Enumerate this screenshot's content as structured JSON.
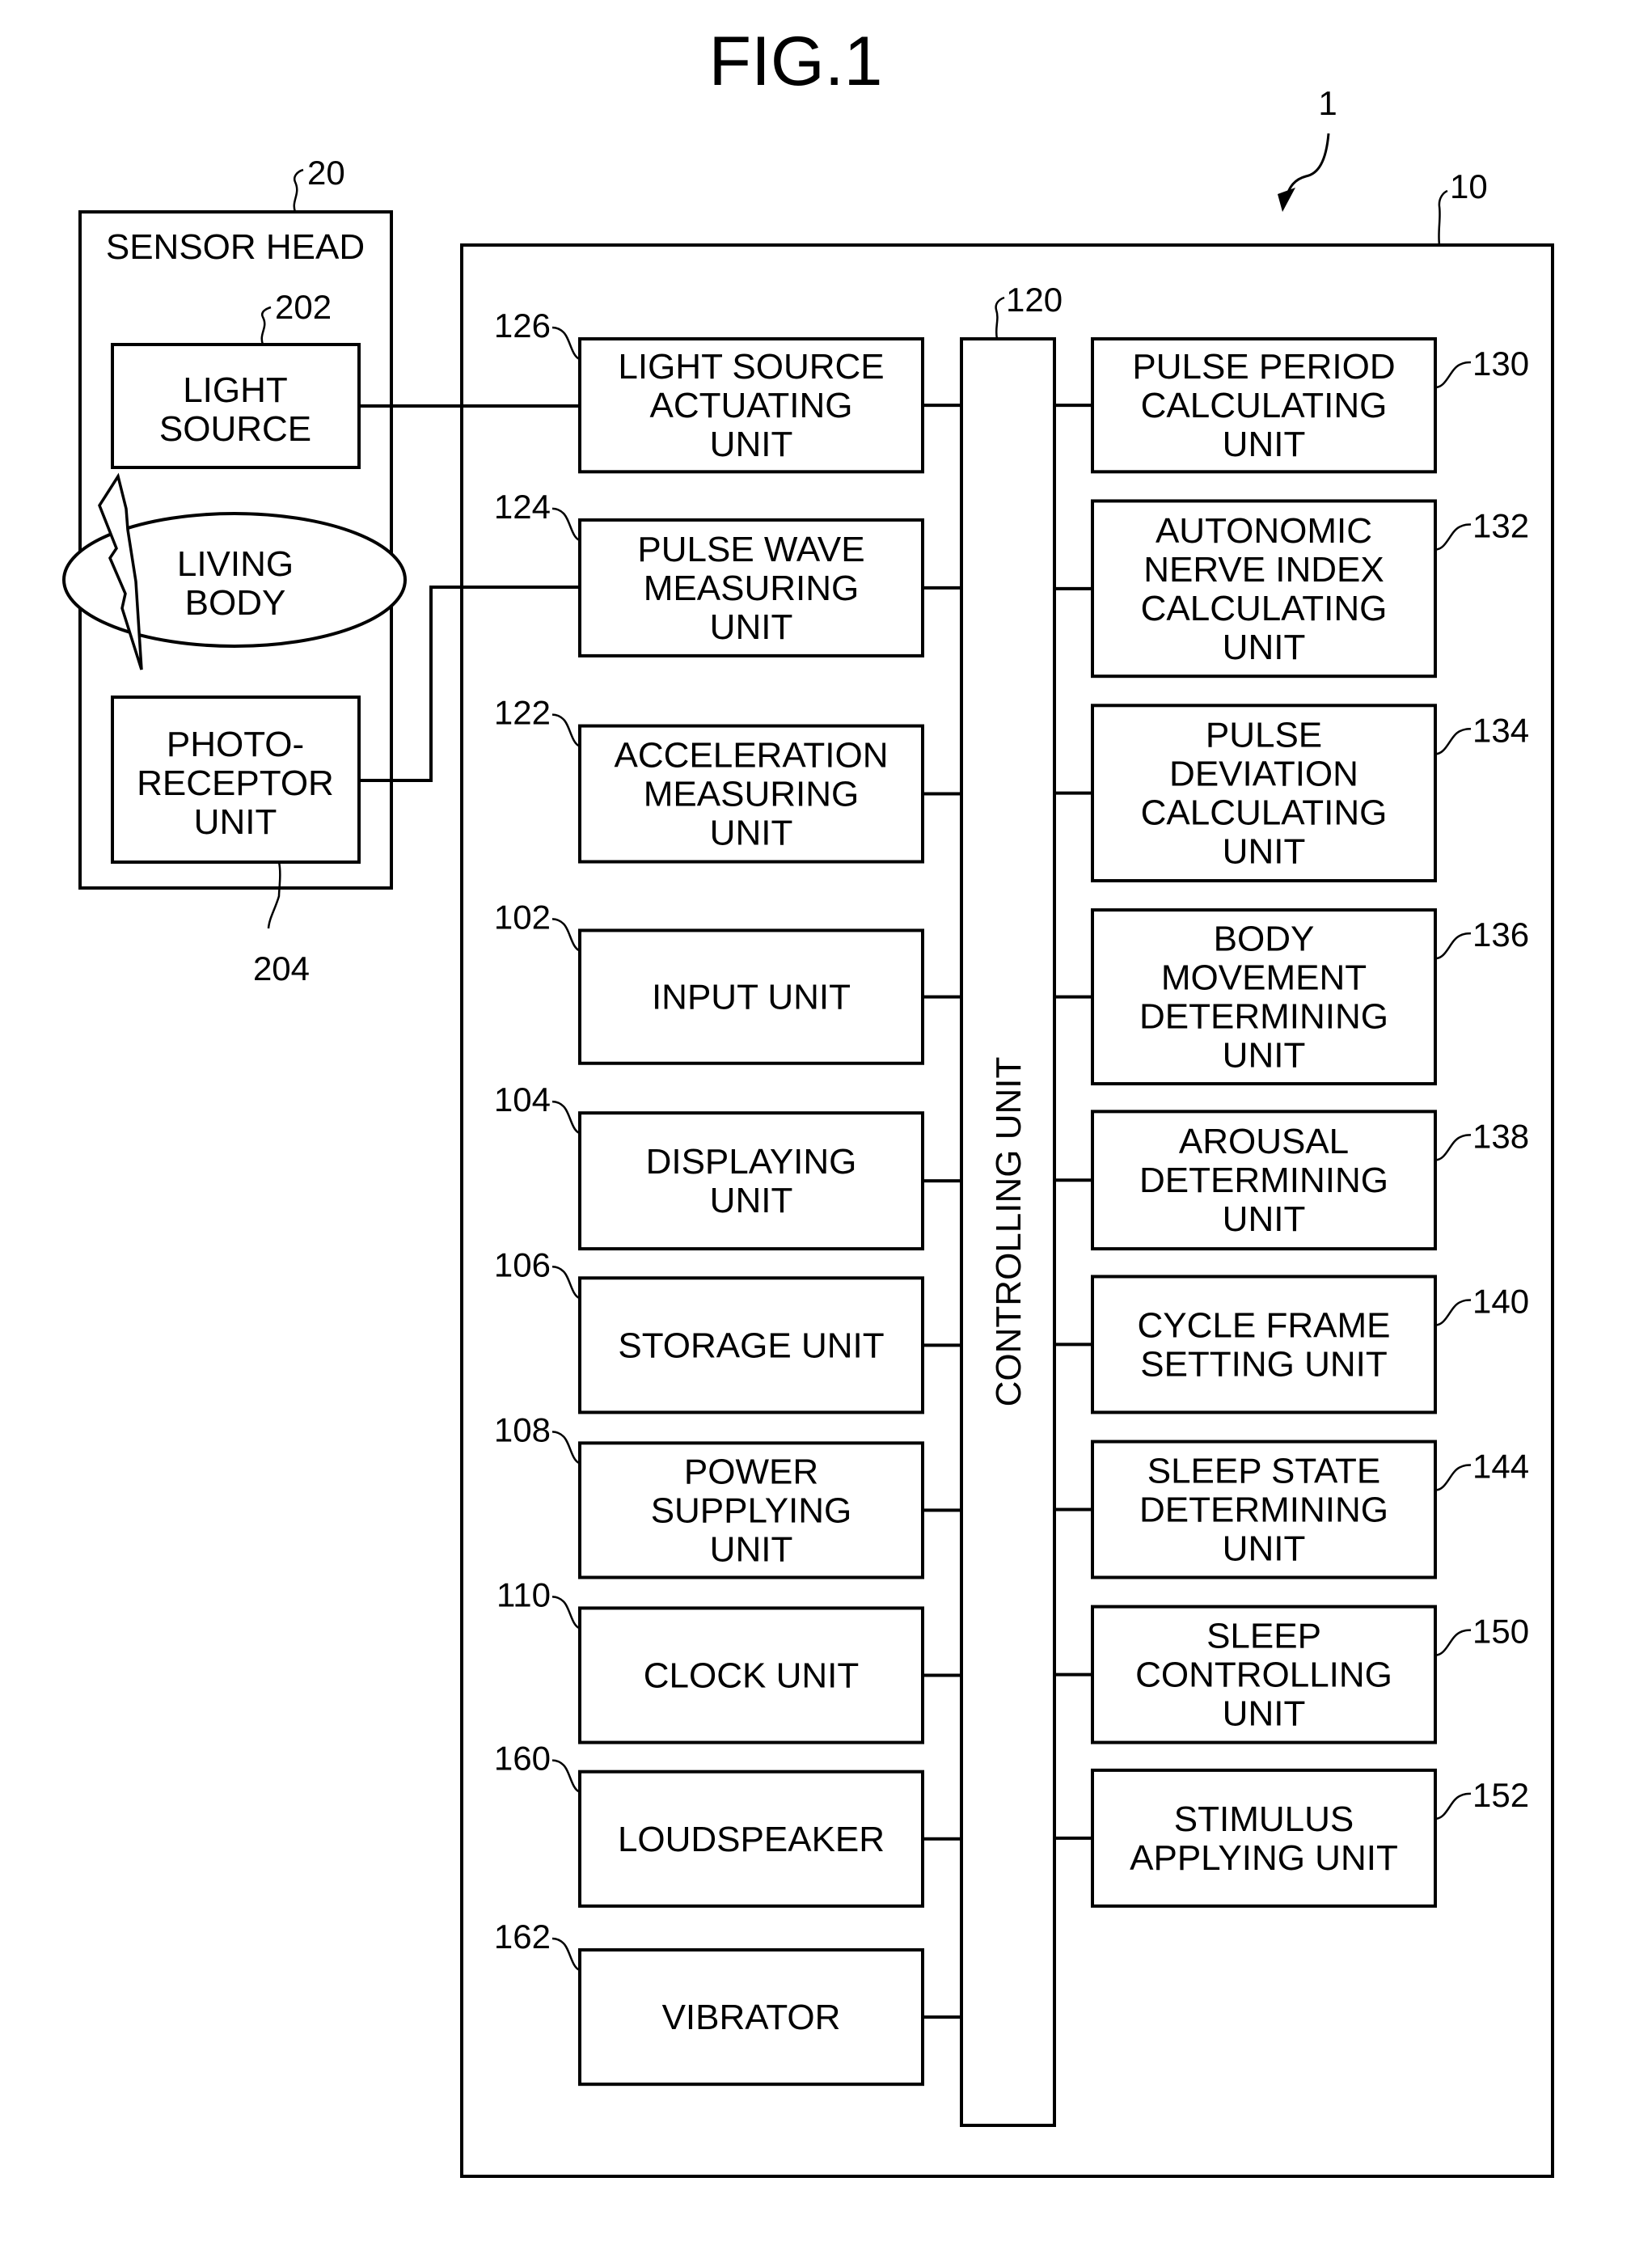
{
  "title": "FIG.1",
  "system_ref": "1",
  "sensor_head": {
    "ref": "20",
    "label": "SENSOR HEAD",
    "light_source": {
      "ref": "202",
      "lines": [
        "LIGHT",
        "SOURCE"
      ]
    },
    "living_body": {
      "lines": [
        "LIVING",
        "BODY"
      ]
    },
    "photoreceptor": {
      "ref": "204",
      "lines": [
        "PHOTO-",
        "RECEPTOR",
        "UNIT"
      ]
    }
  },
  "main_unit": {
    "ref": "10",
    "controller": {
      "ref": "120",
      "label": "CONTROLLING UNIT"
    },
    "left_units": [
      {
        "ref": "126",
        "lines": [
          "LIGHT SOURCE",
          "ACTUATING",
          "UNIT"
        ]
      },
      {
        "ref": "124",
        "lines": [
          "PULSE WAVE",
          "MEASURING",
          "UNIT"
        ]
      },
      {
        "ref": "122",
        "lines": [
          "ACCELERATION",
          "MEASURING",
          "UNIT"
        ]
      },
      {
        "ref": "102",
        "lines": [
          "INPUT UNIT"
        ]
      },
      {
        "ref": "104",
        "lines": [
          "DISPLAYING",
          "UNIT"
        ]
      },
      {
        "ref": "106",
        "lines": [
          "STORAGE UNIT"
        ]
      },
      {
        "ref": "108",
        "lines": [
          "POWER",
          "SUPPLYING",
          "UNIT"
        ]
      },
      {
        "ref": "110",
        "lines": [
          "CLOCK UNIT"
        ]
      },
      {
        "ref": "160",
        "lines": [
          "LOUDSPEAKER"
        ]
      },
      {
        "ref": "162",
        "lines": [
          "VIBRATOR"
        ]
      }
    ],
    "right_units": [
      {
        "ref": "130",
        "lines": [
          "PULSE PERIOD",
          "CALCULATING",
          "UNIT"
        ]
      },
      {
        "ref": "132",
        "lines": [
          "AUTONOMIC",
          "NERVE INDEX",
          "CALCULATING",
          "UNIT"
        ]
      },
      {
        "ref": "134",
        "lines": [
          "PULSE",
          "DEVIATION",
          "CALCULATING",
          "UNIT"
        ]
      },
      {
        "ref": "136",
        "lines": [
          "BODY",
          "MOVEMENT",
          "DETERMINING",
          "UNIT"
        ]
      },
      {
        "ref": "138",
        "lines": [
          "AROUSAL",
          "DETERMINING",
          "UNIT"
        ]
      },
      {
        "ref": "140",
        "lines": [
          "CYCLE FRAME",
          "SETTING UNIT"
        ]
      },
      {
        "ref": "144",
        "lines": [
          "SLEEP STATE",
          "DETERMINING",
          "UNIT"
        ]
      },
      {
        "ref": "150",
        "lines": [
          "SLEEP",
          "CONTROLLING",
          "UNIT"
        ]
      },
      {
        "ref": "152",
        "lines": [
          "STIMULUS",
          "APPLYING UNIT"
        ]
      }
    ]
  }
}
